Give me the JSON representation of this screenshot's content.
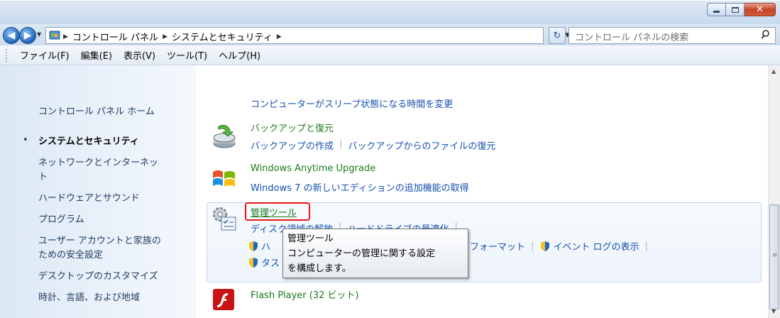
{
  "window": {
    "minimize_icon": "minimize-icon",
    "maximize_icon": "maximize-icon",
    "close_icon": "close-icon",
    "close_glyph": "✕"
  },
  "address_bar": {
    "crumbs": [
      "コントロール パネル",
      "システムとセキュリティ"
    ],
    "search_placeholder": "コントロール パネルの検索"
  },
  "menu": [
    "ファイル(F)",
    "編集(E)",
    "表示(V)",
    "ツール(T)",
    "ヘルプ(H)"
  ],
  "sidebar": {
    "items": [
      {
        "label": "コントロール パネル ホーム"
      },
      {
        "label": "システムとセキュリティ",
        "active": true
      },
      {
        "label": "ネットワークとインターネッ"
      },
      {
        "label": "ト"
      },
      {
        "label": "ハードウェアとサウンド"
      },
      {
        "label": "プログラム"
      },
      {
        "label": "ユーザー アカウントと家族の"
      },
      {
        "label": "ための安全設定"
      },
      {
        "label": "デスクトップのカスタマイズ"
      },
      {
        "label": "時計、言語、および地域"
      }
    ]
  },
  "main": {
    "sleep_link": "コンピューターがスリープ状態になる時間を変更",
    "backup": {
      "title": "バックアップと復元",
      "link1": "バックアップの作成",
      "link2": "バックアップからのファイルの復元"
    },
    "anytime": {
      "title": "Windows Anytime Upgrade",
      "link": "Windows 7 の新しいエディションの追加機能の取得"
    },
    "admin": {
      "title": "管理ツール",
      "link1": "ディスク領域の解放",
      "link2": "ハードドライブの最適化",
      "link3_start": "ハ",
      "link4_end": "フォーマット",
      "link5": "イベント ログの表示",
      "link6_start": "タス"
    },
    "flash": {
      "title": "Flash Player (32 ビット)"
    }
  },
  "tooltip": {
    "title": "管理ツール",
    "line1": "コンピューターの管理に関する設定",
    "line2": "を構成します。"
  },
  "colors": {
    "link": "#1550b0",
    "heading": "#1a7a1a",
    "highlight": "#e21a1a"
  }
}
